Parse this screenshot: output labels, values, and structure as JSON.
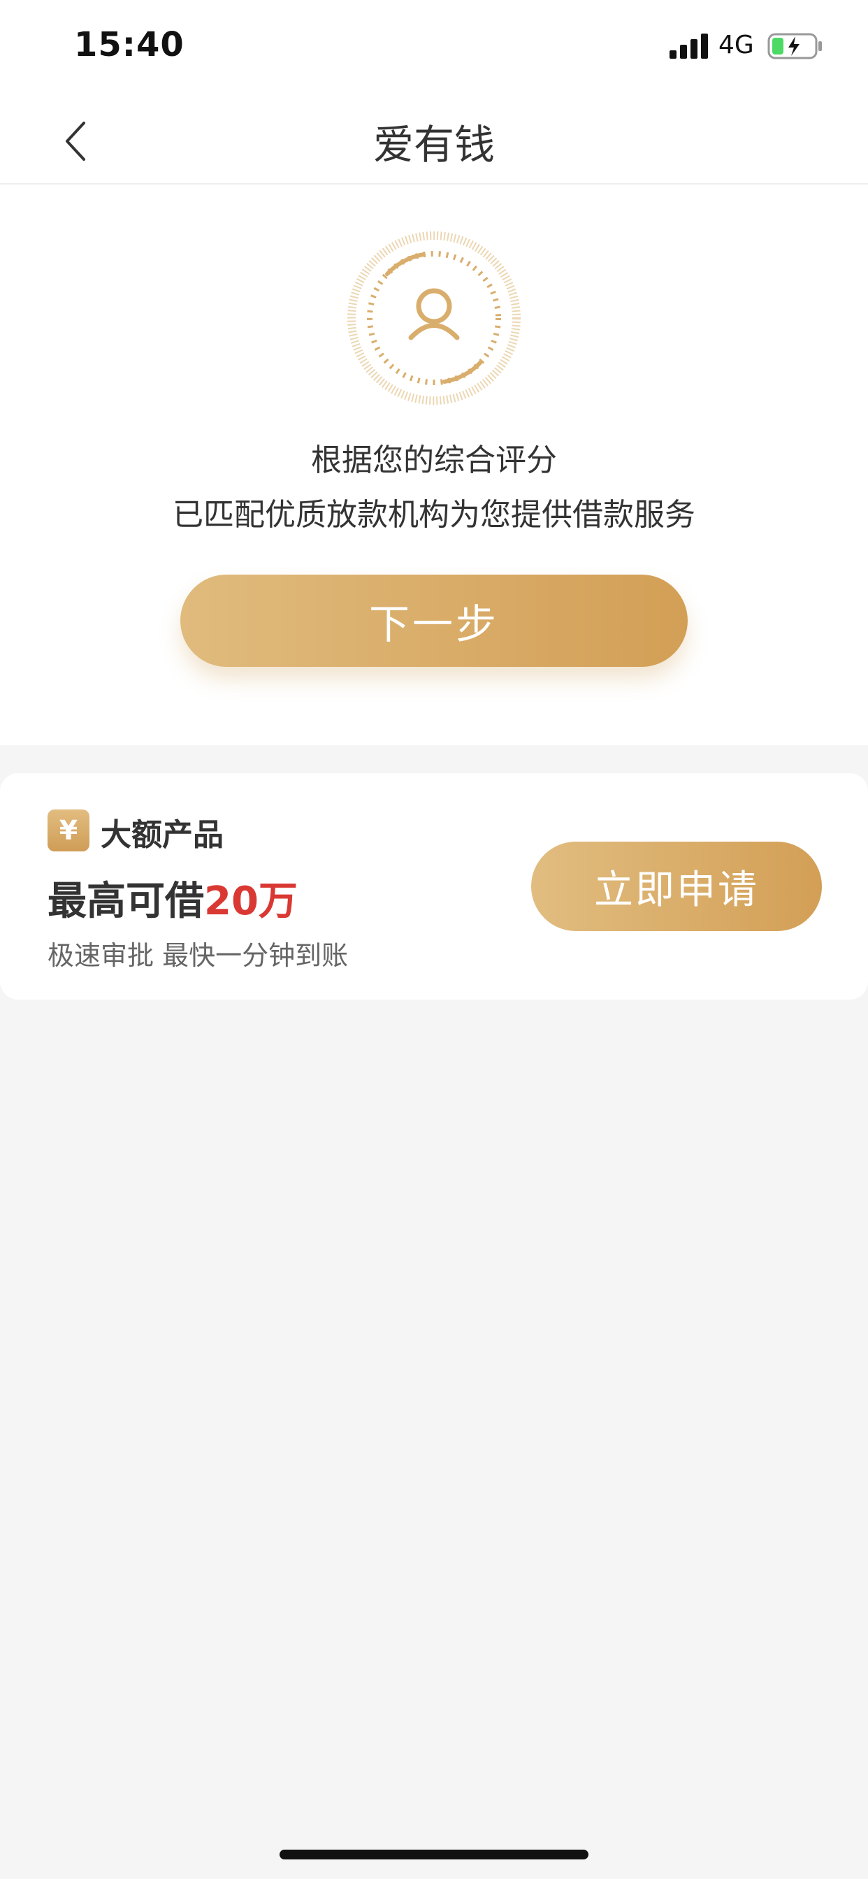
{
  "status_bar": {
    "time": "15:40",
    "network": "4G",
    "signal_icon": "signal-bars-icon",
    "battery_icon": "battery-charging-icon"
  },
  "nav": {
    "title": "爱有钱",
    "back_icon": "chevron-left-icon"
  },
  "match": {
    "icon": "user-score-ring-icon",
    "line1": "根据您的综合评分",
    "line2": "已匹配优质放款机构为您提供借款服务",
    "next_label": "下一步"
  },
  "product": {
    "badge": "¥",
    "category": "大额产品",
    "headline_prefix": "最高可借",
    "headline_amount": "20万",
    "description": "极速审批 最快一分钟到账",
    "apply_label": "立即申请"
  },
  "colors": {
    "accent_gold": "#d8aa65",
    "amount_red": "#d93833",
    "background": "#f5f5f5"
  }
}
